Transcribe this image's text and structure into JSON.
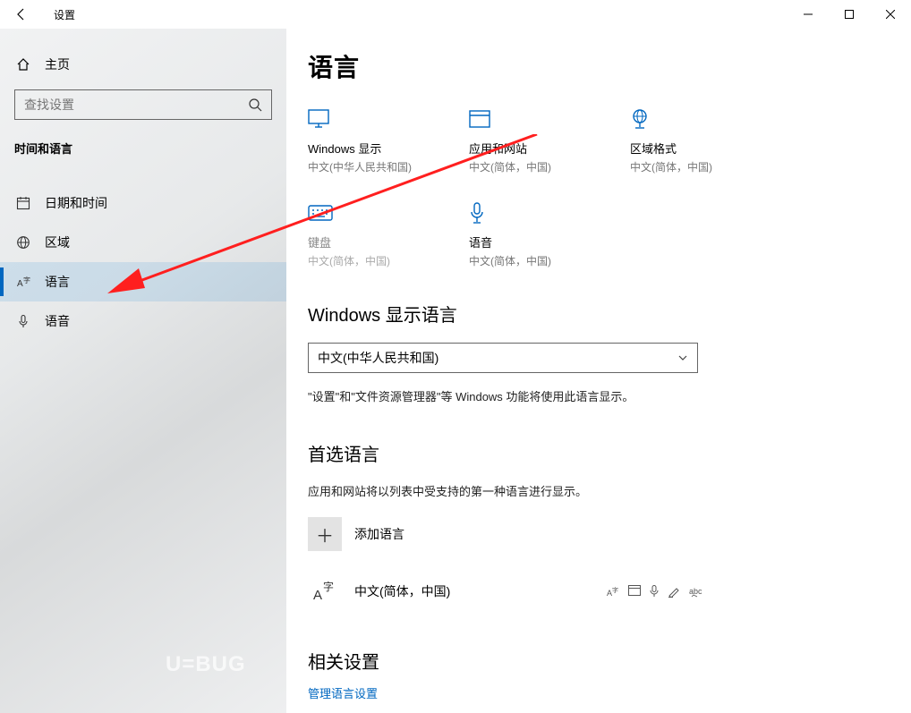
{
  "window": {
    "title": "设置"
  },
  "sidebar": {
    "home": "主页",
    "search_placeholder": "查找设置",
    "category": "时间和语言",
    "items": [
      {
        "label": "日期和时间"
      },
      {
        "label": "区域"
      },
      {
        "label": "语言"
      },
      {
        "label": "语音"
      }
    ]
  },
  "main": {
    "title": "语言",
    "tiles": [
      {
        "label": "Windows 显示",
        "sub": "中文(中华人民共和国)"
      },
      {
        "label": "应用和网站",
        "sub": "中文(简体，中国)"
      },
      {
        "label": "区域格式",
        "sub": "中文(简体，中国)"
      },
      {
        "label": "键盘",
        "sub": "中文(简体，中国)",
        "disabled": true
      },
      {
        "label": "语音",
        "sub": "中文(简体，中国)"
      }
    ],
    "display_lang_heading": "Windows 显示语言",
    "display_lang_value": "中文(中华人民共和国)",
    "display_lang_note": "\"设置\"和\"文件资源管理器\"等 Windows 功能将使用此语言显示。",
    "preferred_heading": "首选语言",
    "preferred_note": "应用和网站将以列表中受支持的第一种语言进行显示。",
    "add_language": "添加语言",
    "installed_lang": "中文(简体，中国)",
    "related_heading": "相关设置",
    "related_link": "管理语言设置"
  },
  "watermark": "U=BUG"
}
